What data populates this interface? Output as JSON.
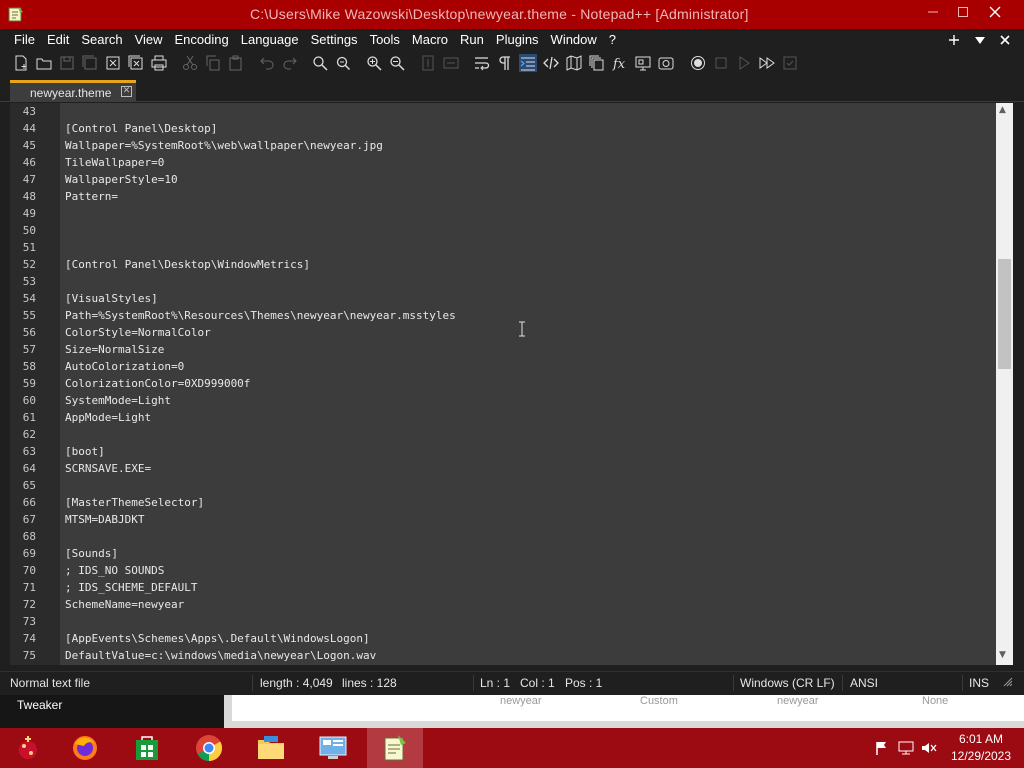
{
  "window": {
    "title": "C:\\Users\\Mike Wazowski\\Desktop\\newyear.theme - Notepad++ [Administrator]",
    "minimize_icon": "minimize-icon",
    "maximize_icon": "maximize-icon",
    "close_icon": "close-icon"
  },
  "menu": {
    "items": [
      "File",
      "Edit",
      "Search",
      "View",
      "Encoding",
      "Language",
      "Settings",
      "Tools",
      "Macro",
      "Run",
      "Plugins",
      "Window",
      "?"
    ],
    "right_icons": [
      "plus-icon",
      "dropdown-arrow-icon",
      "close-icon"
    ]
  },
  "toolbar": {
    "icons": [
      "new-file-icon",
      "open-file-icon",
      "save-icon",
      "save-all-icon",
      "close-file-icon",
      "close-all-icon",
      "print-icon",
      "cut-icon",
      "copy-icon",
      "paste-icon",
      "undo-icon",
      "redo-icon",
      "find-icon",
      "replace-icon",
      "zoom-in-icon",
      "zoom-out-icon",
      "sync-vertical-icon",
      "sync-horizontal-icon",
      "word-wrap-icon",
      "show-all-chars-icon",
      "indent-guide-icon",
      "xml-tags-icon",
      "document-map-icon",
      "document-list-icon",
      "function-list-icon",
      "folder-workspace-icon",
      "monitoring-icon",
      "record-macro-icon",
      "stop-record-icon",
      "play-macro-icon",
      "run-macro-multiple-icon",
      "save-macro-icon"
    ],
    "active_icon": "indent-guide-icon"
  },
  "tabs": [
    {
      "label": "newyear.theme",
      "active": true
    }
  ],
  "editor": {
    "lines": [
      {
        "n": "43",
        "text": ""
      },
      {
        "n": "44",
        "text": "[Control Panel\\Desktop]"
      },
      {
        "n": "45",
        "text": "Wallpaper=%SystemRoot%\\web\\wallpaper\\newyear.jpg"
      },
      {
        "n": "46",
        "text": "TileWallpaper=0"
      },
      {
        "n": "47",
        "text": "WallpaperStyle=10"
      },
      {
        "n": "48",
        "text": "Pattern="
      },
      {
        "n": "49",
        "text": ""
      },
      {
        "n": "50",
        "text": ""
      },
      {
        "n": "51",
        "text": ""
      },
      {
        "n": "52",
        "text": "[Control Panel\\Desktop\\WindowMetrics]"
      },
      {
        "n": "53",
        "text": ""
      },
      {
        "n": "54",
        "text": "[VisualStyles]"
      },
      {
        "n": "55",
        "text": "Path=%SystemRoot%\\Resources\\Themes\\newyear\\newyear.msstyles"
      },
      {
        "n": "56",
        "text": "ColorStyle=NormalColor"
      },
      {
        "n": "57",
        "text": "Size=NormalSize"
      },
      {
        "n": "58",
        "text": "AutoColorization=0"
      },
      {
        "n": "59",
        "text": "ColorizationColor=0XD999000f"
      },
      {
        "n": "60",
        "text": "SystemMode=Light"
      },
      {
        "n": "61",
        "text": "AppMode=Light"
      },
      {
        "n": "62",
        "text": ""
      },
      {
        "n": "63",
        "text": "[boot]"
      },
      {
        "n": "64",
        "text": "SCRNSAVE.EXE="
      },
      {
        "n": "65",
        "text": ""
      },
      {
        "n": "66",
        "text": "[MasterThemeSelector]"
      },
      {
        "n": "67",
        "text": "MTSM=DABJDKT"
      },
      {
        "n": "68",
        "text": ""
      },
      {
        "n": "69",
        "text": "[Sounds]"
      },
      {
        "n": "70",
        "text": "; IDS_NO SOUNDS"
      },
      {
        "n": "71",
        "text": "; IDS_SCHEME_DEFAULT"
      },
      {
        "n": "72",
        "text": "SchemeName=newyear"
      },
      {
        "n": "73",
        "text": ""
      },
      {
        "n": "74",
        "text": "[AppEvents\\Schemes\\Apps\\.Default\\WindowsLogon]"
      },
      {
        "n": "75",
        "text": "DefaultValue=c:\\windows\\media\\newyear\\Logon.wav"
      }
    ]
  },
  "status": {
    "file_type": "Normal text file",
    "length": "length : 4,049",
    "lines": "lines : 128",
    "ln": "Ln : 1",
    "col": "Col : 1",
    "pos": "Pos : 1",
    "eol": "Windows (CR LF)",
    "encoding": "ANSI",
    "mode": "INS"
  },
  "background_window": {
    "label": "Tweaker",
    "ghost_texts": [
      "newyear",
      "Custom",
      "newyear",
      "None"
    ]
  },
  "taskbar": {
    "apps": [
      "start-ornament-icon",
      "firefox-icon",
      "store-icon",
      "chrome-icon",
      "file-explorer-icon",
      "control-panel-icon",
      "notepadpp-icon"
    ],
    "running_app": "notepadpp-icon",
    "tray_icons": [
      "flag-icon",
      "network-icon",
      "volume-muted-icon"
    ],
    "time": "6:01 AM",
    "date": "12/29/2023"
  },
  "colors": {
    "titlebar": "#a80000",
    "taskbar": "#9c0a12",
    "editor_bg": "#3c3c3c",
    "tab_accent": "#e8a51c"
  }
}
